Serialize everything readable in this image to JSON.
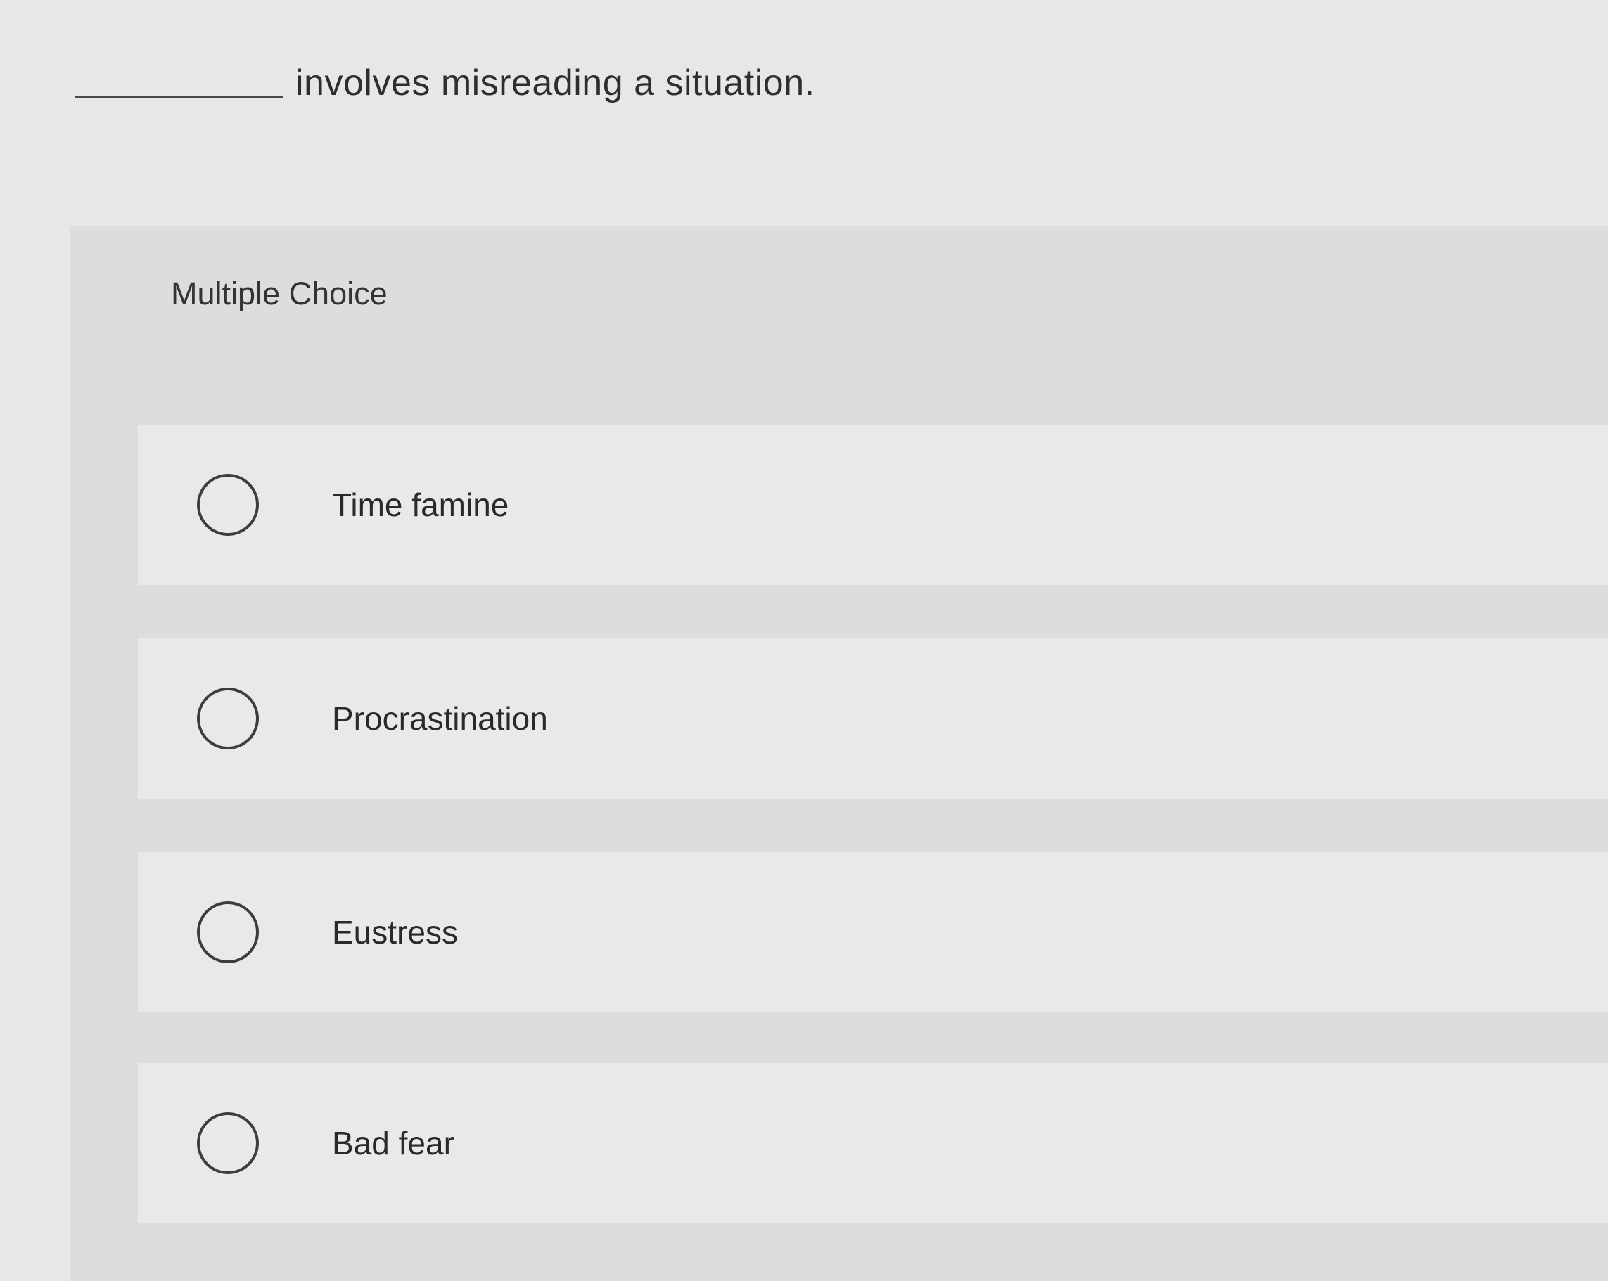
{
  "question": {
    "text": "involves misreading a situation."
  },
  "section": {
    "heading": "Multiple Choice"
  },
  "options": [
    {
      "label": "Time famine"
    },
    {
      "label": "Procrastination"
    },
    {
      "label": "Eustress"
    },
    {
      "label": "Bad fear"
    }
  ]
}
